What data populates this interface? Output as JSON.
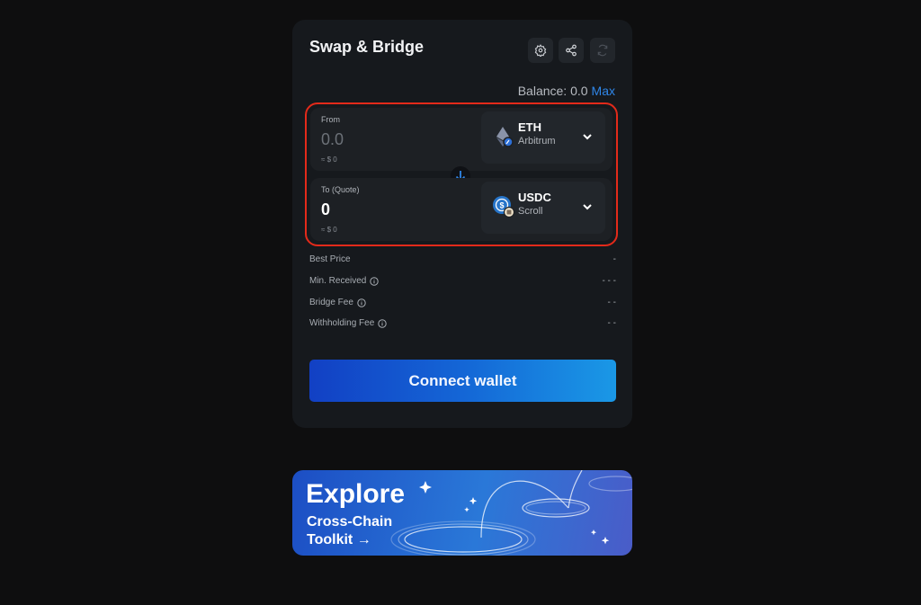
{
  "header": {
    "title": "Swap & Bridge",
    "icons": [
      "gear-icon",
      "share-icon",
      "refresh-icon"
    ]
  },
  "balance": {
    "label": "Balance: 0.0",
    "max_label": "Max"
  },
  "from": {
    "label": "From",
    "amount_placeholder": "0.0",
    "usd_value": "≈ $ 0",
    "token": "ETH",
    "chain": "Arbitrum"
  },
  "to": {
    "label": "To (Quote)",
    "amount": "0",
    "usd_value": "≈ $ 0",
    "token": "USDC",
    "chain": "Scroll"
  },
  "details": [
    {
      "label": "Best Price",
      "value": "-",
      "info": false
    },
    {
      "label": "Min. Received",
      "value": "- - -",
      "info": true
    },
    {
      "label": "Bridge Fee",
      "value": "- -",
      "info": true
    },
    {
      "label": "Withholding Fee",
      "value": "- -",
      "info": true
    }
  ],
  "connect_button": "Connect wallet",
  "banner": {
    "title": "Explore",
    "subtitle_line1": "Cross-Chain",
    "subtitle_line2": "Toolkit →"
  },
  "colors": {
    "accent": "#2f86e8",
    "highlight_border": "#e32a1a",
    "card_bg": "#16191d"
  }
}
